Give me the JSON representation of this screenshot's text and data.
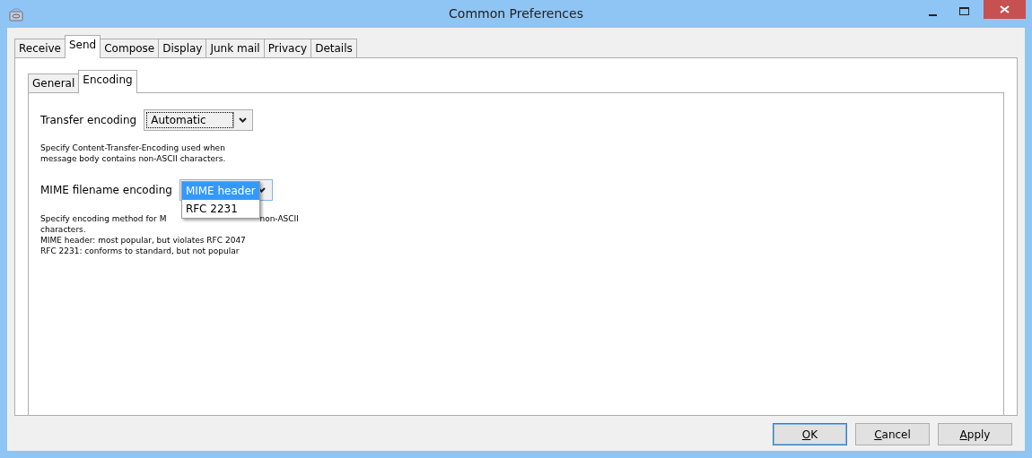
{
  "window": {
    "title": "Common Preferences"
  },
  "tabs": [
    {
      "label": "Receive",
      "selected": false
    },
    {
      "label": "Send",
      "selected": true
    },
    {
      "label": "Compose",
      "selected": false
    },
    {
      "label": "Display",
      "selected": false
    },
    {
      "label": "Junk mail",
      "selected": false
    },
    {
      "label": "Privacy",
      "selected": false
    },
    {
      "label": "Details",
      "selected": false
    }
  ],
  "subtabs": [
    {
      "label": "General",
      "selected": false
    },
    {
      "label": "Encoding",
      "selected": true
    }
  ],
  "transfer_encoding": {
    "label": "Transfer encoding",
    "value": "Automatic",
    "description": [
      "Specify Content-Transfer-Encoding used when",
      "message body contains non-ASCII characters."
    ]
  },
  "mime_filename_encoding": {
    "label": "MIME filename encoding",
    "expanded": true,
    "options": [
      {
        "label": "MIME header",
        "selected": true
      },
      {
        "label": "RFC 2231",
        "selected": false
      }
    ],
    "description_first_line": [
      "Specify encoding method for M",
      "non-ASCII"
    ],
    "description": [
      "characters.",
      "MIME header: most popular, but violates RFC 2047",
      "RFC 2231: conforms to standard, but not popular"
    ]
  },
  "buttons": [
    {
      "label": "OK",
      "default": true
    },
    {
      "label": "Cancel",
      "default": false
    },
    {
      "label": "Apply",
      "default": false
    }
  ]
}
